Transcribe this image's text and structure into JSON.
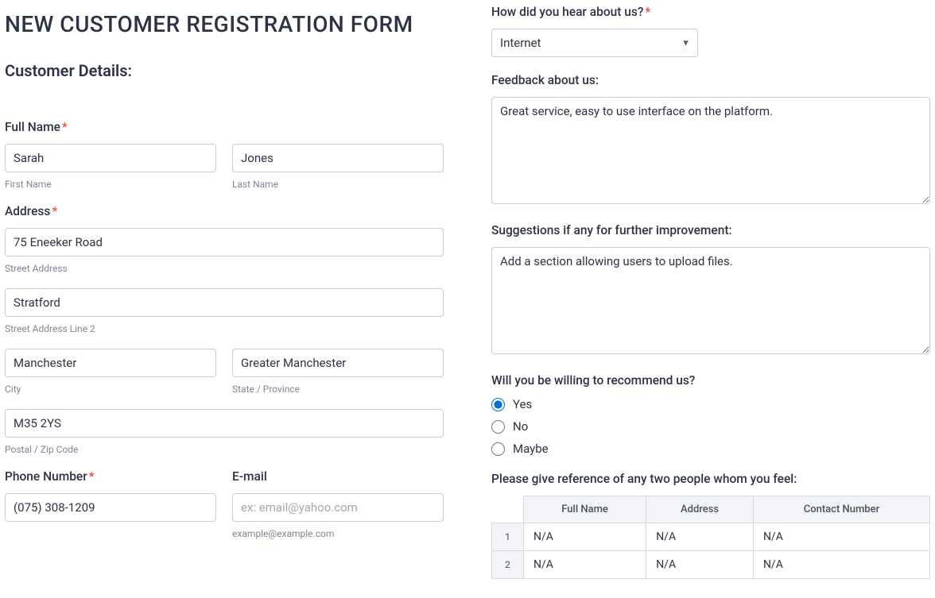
{
  "header": {
    "title": "NEW CUSTOMER REGISTRATION FORM",
    "subtitle": "Customer Details:"
  },
  "fullName": {
    "label": "Full Name",
    "first": "Sarah",
    "last": "Jones",
    "firstSub": "First Name",
    "lastSub": "Last Name"
  },
  "address": {
    "label": "Address",
    "street": "75 Eneeker Road",
    "streetSub": "Street Address",
    "street2": "Stratford",
    "street2Sub": "Street Address Line 2",
    "city": "Manchester",
    "citySub": "City",
    "state": "Greater Manchester",
    "stateSub": "State / Province",
    "postal": "M35 2YS",
    "postalSub": "Postal / Zip Code"
  },
  "phone": {
    "label": "Phone Number",
    "value": "(075) 308-1209"
  },
  "email": {
    "label": "E-mail",
    "placeholder": "ex: email@yahoo.com",
    "sub": "example@example.com"
  },
  "hear": {
    "label": "How did you hear about us?",
    "selected": "Internet"
  },
  "feedback": {
    "label": "Feedback about us:",
    "value": "Great service, easy to use interface on the platform."
  },
  "suggestions": {
    "label": "Suggestions if any for further improvement:",
    "value": "Add a section allowing users to upload files."
  },
  "recommend": {
    "label": "Will you be willing to recommend us?",
    "options": {
      "yes": "Yes",
      "no": "No",
      "maybe": "Maybe"
    },
    "selected": "yes"
  },
  "reference": {
    "label": "Please give reference of any two people whom you feel:",
    "cols": {
      "name": "Full Name",
      "address": "Address",
      "contact": "Contact Number"
    },
    "rows": [
      {
        "num": "1",
        "name": "N/A",
        "address": "N/A",
        "contact": "N/A"
      },
      {
        "num": "2",
        "name": "N/A",
        "address": "N/A",
        "contact": "N/A"
      }
    ]
  }
}
